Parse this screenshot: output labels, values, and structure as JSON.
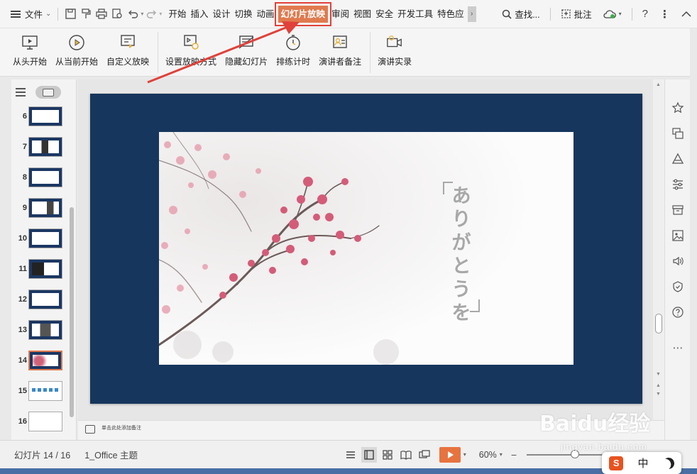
{
  "topbar": {
    "file_label": "文件",
    "tabs": [
      "开始",
      "插入",
      "设计",
      "切换",
      "动画",
      "幻灯片放映",
      "审阅",
      "视图",
      "安全",
      "开发工具",
      "特色应"
    ],
    "active_tab": "幻灯片放映",
    "search_label": "查找...",
    "comment_label": "批注"
  },
  "ribbon": {
    "buttons": [
      {
        "label": "从头开始",
        "icon": "monitor-play-icon"
      },
      {
        "label": "从当前开始",
        "icon": "play-circle-icon"
      },
      {
        "label": "自定义放映",
        "icon": "custom-show-icon"
      },
      {
        "label": "设置放映方式",
        "icon": "setup-show-icon"
      },
      {
        "label": "隐藏幻灯片",
        "icon": "hide-slide-icon"
      },
      {
        "label": "排练计时",
        "icon": "stopwatch-icon"
      },
      {
        "label": "演讲者备注",
        "icon": "speaker-notes-icon"
      },
      {
        "label": "演讲实录",
        "icon": "record-icon"
      }
    ]
  },
  "thumbnails": {
    "items": [
      {
        "num": "6"
      },
      {
        "num": "7"
      },
      {
        "num": "8"
      },
      {
        "num": "9"
      },
      {
        "num": "10"
      },
      {
        "num": "11"
      },
      {
        "num": "12"
      },
      {
        "num": "13"
      },
      {
        "num": "14"
      },
      {
        "num": "15"
      },
      {
        "num": "16"
      }
    ],
    "selected": "14"
  },
  "slide": {
    "vertical_text": [
      "あ",
      "り",
      "が",
      "と",
      "う",
      "を"
    ],
    "background_color": "#17365d"
  },
  "notes": {
    "placeholder": "单击此处添加备注"
  },
  "status": {
    "slide_info": "幻灯片 14 / 16",
    "theme": "1_Office 主题",
    "zoom": "60%"
  },
  "watermark": {
    "main": "Baidu经验",
    "sub": "jingyan.baidu.com"
  },
  "ime": {
    "logo": "S",
    "mode": "中"
  },
  "colors": {
    "accent": "#e07a4e",
    "annotation_red": "#e0413a",
    "slide_navy": "#17365d"
  }
}
